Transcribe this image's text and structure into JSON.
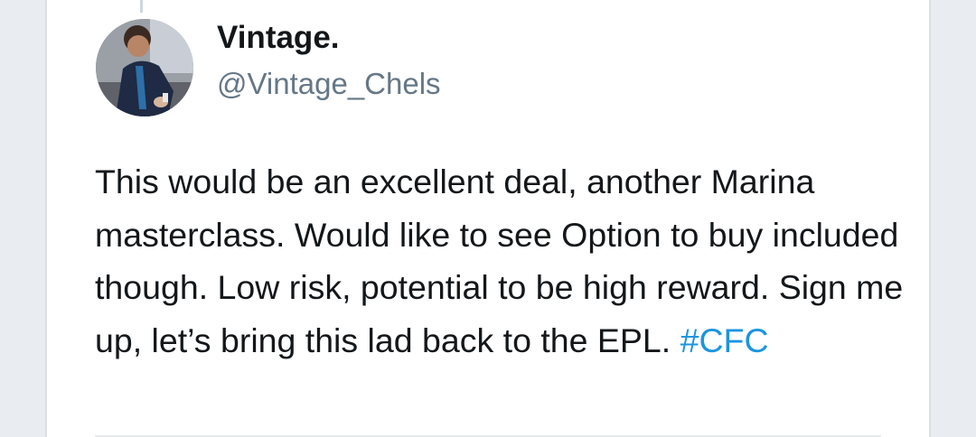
{
  "tweet": {
    "author_name": "Vintage.",
    "author_handle": "@Vintage_Chels",
    "text_before_hashtag": "This would be an excellent deal, another Marina masterclass. Would like to see Option to buy included though. Low risk, potential to be high reward. Sign me up, let’s bring this lad back to the EPL. ",
    "hashtag": "#CFC"
  },
  "colors": {
    "hashtag": "#1b95e0",
    "handle": "#657786",
    "text": "#14171a"
  }
}
